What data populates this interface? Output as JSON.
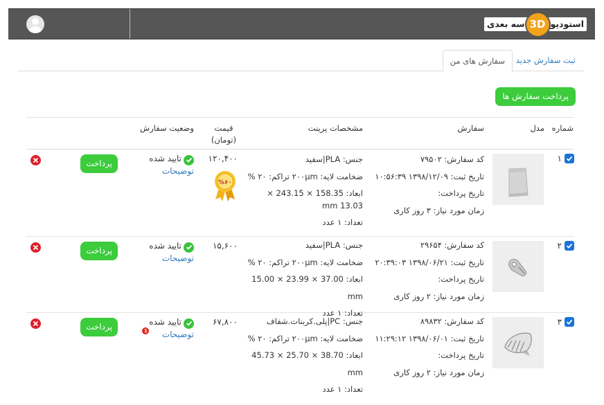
{
  "header": {
    "logo_left": "سه بعدی",
    "logo_mark": "3D",
    "logo_right": "استودیو",
    "avatar_icon": "user-avatar-icon"
  },
  "tabs": [
    {
      "label": "ثبت سفارش جدید",
      "active": false
    },
    {
      "label": "سفارش های من",
      "active": true
    }
  ],
  "pay_orders_label": "پرداخت سفارش ها",
  "table": {
    "headers": {
      "number": "شماره",
      "model": "مدل",
      "order": "سفارش",
      "print_specs": "مشخصات پرینت",
      "price_line1": "قیمت",
      "price_line2": "(تومان)",
      "status": "وضعیت سفارش"
    },
    "rows": [
      {
        "number": "۱",
        "order_code": "کد سفارش: ۷۹۵۰۲",
        "reg_date": "تاریخ ثبت: ۱۳۹۸/۱۲/۰۹ ۱۰:۵۶:۳۹",
        "pay_date": "تاریخ پرداخت:",
        "time_needed": "زمان مورد نیاز: ۳ روز کاری",
        "material": "جنس: PLA|سفید",
        "layer": "ضخامت لایه: ۲۰۰μm  تراکم: ۲۰ %",
        "dims": "ابعاد: 158.35 × 243.15 × 13.03 mm",
        "count": "تعداد: ۱ عدد",
        "price": "۱۲۰,۴۰۰",
        "discount_label": "%۶۰",
        "status": "تایید شده",
        "desc": "توضیحات",
        "desc_badge": "",
        "pay_label": "پرداخت",
        "thumb_icon": "part-model-thumb"
      },
      {
        "number": "۲",
        "order_code": "کد سفارش: ۲۹۶۵۴",
        "reg_date": "تاریخ ثبت: ۱۳۹۸/۰۶/۲۱ ۲۰:۳۹:۰۳",
        "pay_date": "تاریخ پرداخت:",
        "time_needed": "زمان مورد نیاز: ۲ روز کاری",
        "material": "جنس: PLA|سفید",
        "layer": "ضخامت لایه: ۲۰۰μm  تراکم: ۲۰ %",
        "dims": "ابعاد: 37.00 × 23.99 × 15.00 mm",
        "count": "تعداد: ۱ عدد",
        "price": "۱۵,۶۰۰",
        "discount_label": "",
        "status": "تایید شده",
        "desc": "توضیحات",
        "desc_badge": "",
        "pay_label": "پرداخت",
        "thumb_icon": "clip-model-thumb"
      },
      {
        "number": "۳",
        "order_code": "کد سفارش: ۸۹۸۳۲",
        "reg_date": "تاریخ ثبت: ۱۳۹۸/۰۶/۰۱ ۱۱:۲۹:۱۲",
        "pay_date": "تاریخ پرداخت:",
        "time_needed": "زمان مورد نیاز: ۲ روز کاری",
        "material": "جنس: PC|پلی.کربنات.شفاف",
        "layer": "ضخامت لایه: ۲۰۰μm  تراکم: ۲۰ %",
        "dims": "ابعاد: 38.70 × 25.70 × 45.73 mm",
        "count": "تعداد: ۱ عدد",
        "price": "۶۷,۸۰۰",
        "discount_label": "",
        "status": "تایید شده",
        "desc": "توضیحات",
        "desc_badge": "1",
        "pay_label": "پرداخت",
        "thumb_icon": "shell-model-thumb"
      }
    ]
  },
  "colors": {
    "topbar": "#565656",
    "green": "#3ccc3c",
    "blue_link": "#2f7bbf",
    "check_blue": "#1a73d9",
    "red": "#e0202a",
    "logo_orange": "#f2a31a"
  }
}
